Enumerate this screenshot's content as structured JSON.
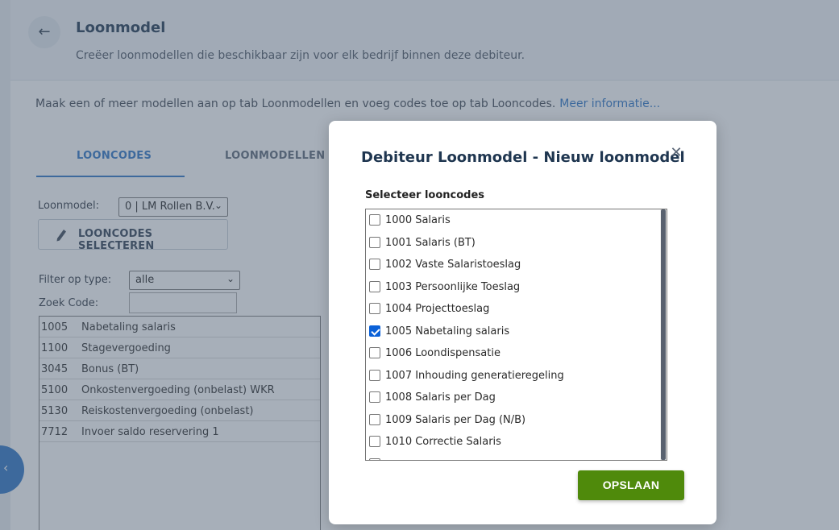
{
  "header": {
    "back_icon": "arrow-left-icon",
    "title": "Loonmodel",
    "subtitle": "Creëer loonmodellen die beschikbaar zijn voor elk bedrijf binnen deze debiteur."
  },
  "info": {
    "text": "Maak een of meer modellen aan op tab Loonmodellen en voeg codes toe op tab Looncodes.",
    "link": "Meer informatie..."
  },
  "tabs": [
    {
      "label": "LOONCODES",
      "active": true
    },
    {
      "label": "LOONMODELLEN",
      "active": false
    }
  ],
  "form": {
    "loonmodel_label": "Loonmodel:",
    "loonmodel_value": "0 | LM Rollen B.V.",
    "select_button": "LOONCODES SELECTEREN",
    "filter_label": "Filter op type:",
    "filter_value": "alle",
    "search_label": "Zoek Code:",
    "search_value": ""
  },
  "codes": [
    {
      "code": "1005",
      "desc": "Nabetaling salaris"
    },
    {
      "code": "1100",
      "desc": "Stagevergoeding"
    },
    {
      "code": "3045",
      "desc": "Bonus (BT)"
    },
    {
      "code": "5100",
      "desc": "Onkostenvergoeding (onbelast) WKR"
    },
    {
      "code": "5130",
      "desc": "Reiskostenvergoeding (onbelast)"
    },
    {
      "code": "7712",
      "desc": "Invoer saldo reservering 1"
    }
  ],
  "modal": {
    "title": "Debiteur Loonmodel - Nieuw loonmodel",
    "close_icon": "close-icon",
    "section_label": "Selecteer looncodes",
    "items": [
      {
        "label": "1000 Salaris",
        "checked": false
      },
      {
        "label": "1001 Salaris (BT)",
        "checked": false
      },
      {
        "label": "1002 Vaste Salaristoeslag",
        "checked": false
      },
      {
        "label": "1003 Persoonlijke Toeslag",
        "checked": false
      },
      {
        "label": "1004 Projecttoeslag",
        "checked": false
      },
      {
        "label": "1005 Nabetaling salaris",
        "checked": true
      },
      {
        "label": "1006 Loondispensatie",
        "checked": false
      },
      {
        "label": "1007 Inhouding generatieregeling",
        "checked": false
      },
      {
        "label": "1008 Salaris per Dag",
        "checked": false
      },
      {
        "label": "1009 Salaris per Dag (N/B)",
        "checked": false
      },
      {
        "label": "1010 Correctie Salaris",
        "checked": false
      }
    ],
    "save_label": "OPSLAAN"
  },
  "colors": {
    "accent": "#2a73c5",
    "save": "#4f8a0b",
    "title": "#1f3650"
  }
}
